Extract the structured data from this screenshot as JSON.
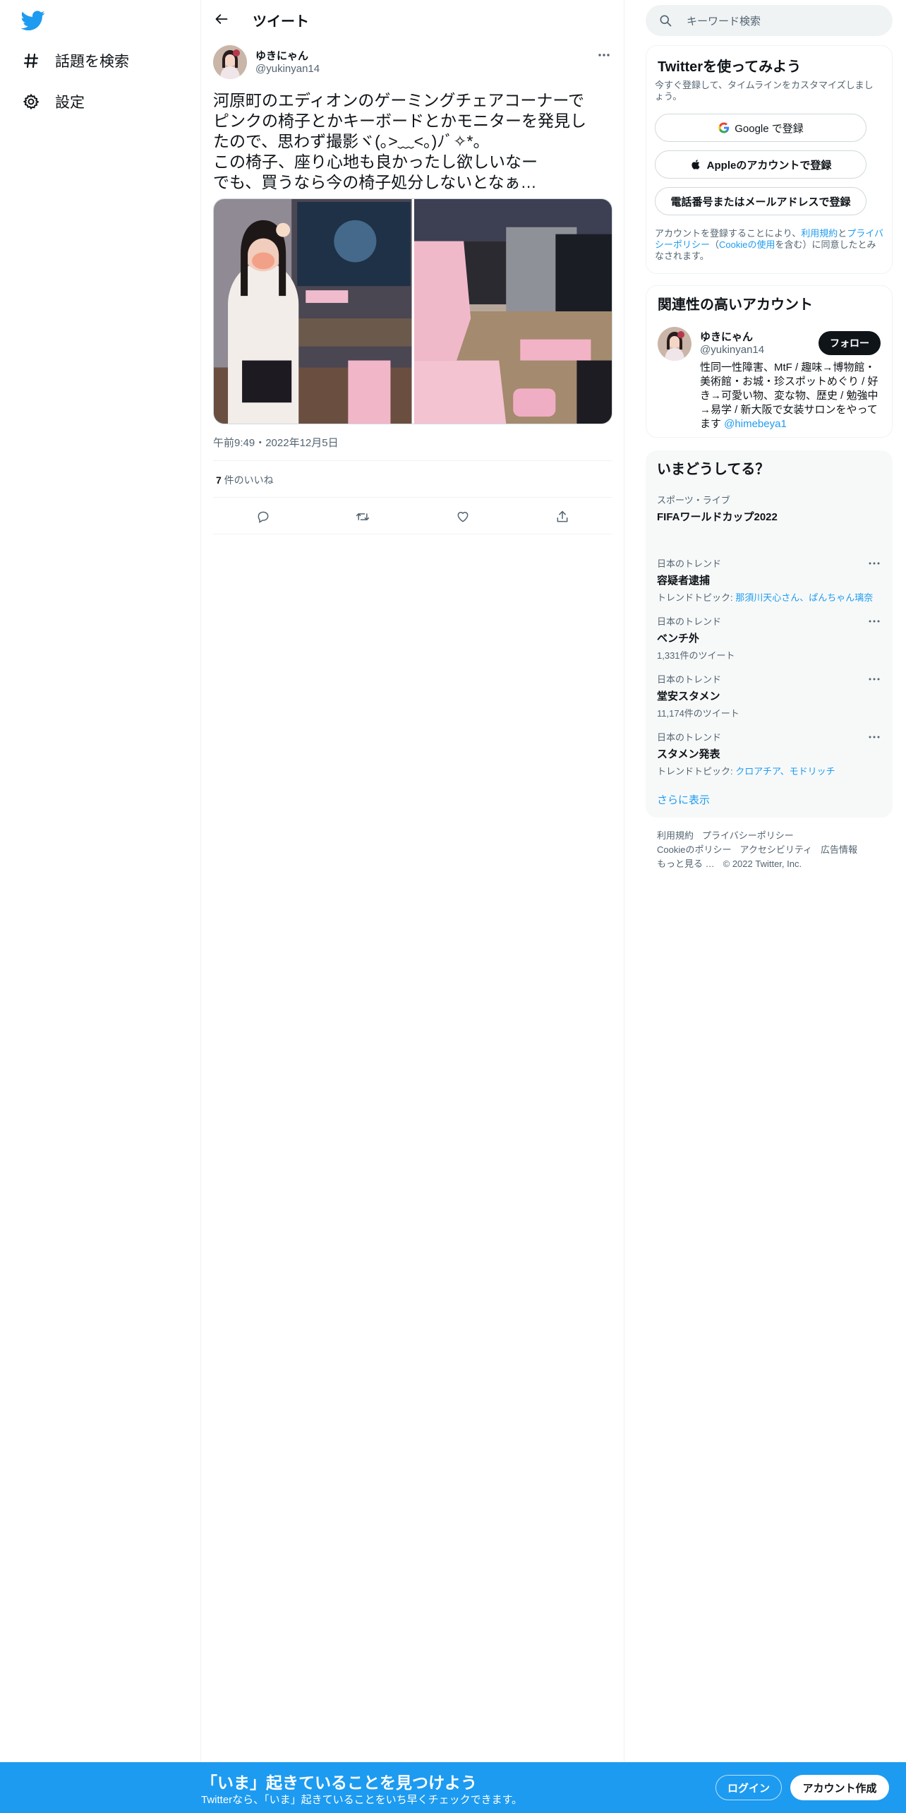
{
  "colors": {
    "brand": "#1d9bf0",
    "text": "#0f1419",
    "muted": "#536471",
    "border": "#eff3f4",
    "pink": "#f2b6c9"
  },
  "nav": {
    "explore_label": "話題を検索",
    "settings_label": "設定"
  },
  "header": {
    "title": "ツイート"
  },
  "tweet": {
    "author_name": "ゆきにゃん",
    "author_handle": "@yukinyan14",
    "text": "河原町のエディオンのゲーミングチェアコーナーで\nピンクの椅子とかキーボードとかモニターを発見し\nたので、思わず撮影ヾ(｡>﹏<｡)ﾉﾞ✧*。\nこの椅子、座り心地も良かったし欲しいなー\nでも、買うなら今の椅子処分しないとなぁ…",
    "timestamp": "午前9:49・2022年12月5日",
    "likes_count": "7",
    "likes_label": " 件のいいね"
  },
  "search": {
    "placeholder": "キーワード検索"
  },
  "signup_card": {
    "title": "Twitterを使ってみよう",
    "subtitle": "今すぐ登録して、タイムラインをカスタマイズしましょう。",
    "google_label": "Google で登録",
    "apple_label": "Appleのアカウントで登録",
    "phone_label": "電話番号またはメールアドレスで登録",
    "legal_pre": "アカウントを登録することにより、",
    "legal_terms": "利用規約",
    "legal_and": "と",
    "legal_privacy": "プライバシーポリシー",
    "legal_paren_open": "（",
    "legal_cookie": "Cookieの使用",
    "legal_post": "を含む）に同意したとみなされます。"
  },
  "related": {
    "title": "関連性の高いアカウント",
    "name": "ゆきにゃん",
    "handle": "@yukinyan14",
    "follow_label": "フォロー",
    "bio": "性同一性障害、MtF / 趣味→博物館・美術館・お城・珍スポットめぐり / 好き→可愛い物、変な物、歴史 / 勉強中→易学 / 新大阪で女装サロンをやってます ",
    "bio_mention": "@himebeya1"
  },
  "trends": {
    "title": "いまどうしてる？",
    "items": [
      {
        "context": "スポーツ・ライブ",
        "name": "FIFAワールドカップ2022",
        "meta": "",
        "meta_link": ""
      },
      {
        "context": "日本のトレンド",
        "name": "容疑者逮捕",
        "meta": "トレンドトピック: ",
        "meta_link": "那須川天心さん、ぱんちゃん璃奈"
      },
      {
        "context": "日本のトレンド",
        "name": "ベンチ外",
        "meta": "1,331件のツイート",
        "meta_link": ""
      },
      {
        "context": "日本のトレンド",
        "name": "堂安スタメン",
        "meta": "11,174件のツイート",
        "meta_link": ""
      },
      {
        "context": "日本のトレンド",
        "name": "スタメン発表",
        "meta": "トレンドトピック: ",
        "meta_link": "クロアチア、モドリッチ"
      }
    ],
    "show_more": "さらに表示"
  },
  "footer": {
    "terms": "利用規約",
    "privacy": "プライバシーポリシー",
    "cookie": "Cookieのポリシー",
    "accessibility": "アクセシビリティ",
    "ads": "広告情報",
    "more": "もっと見る …",
    "copyright": "© 2022 Twitter, Inc."
  },
  "bottom_bar": {
    "title": "「いま」起きていることを見つけよう",
    "subtitle": "Twitterなら、「いま」起きていることをいち早くチェックできます。",
    "login_label": "ログイン",
    "signup_label": "アカウント作成"
  }
}
